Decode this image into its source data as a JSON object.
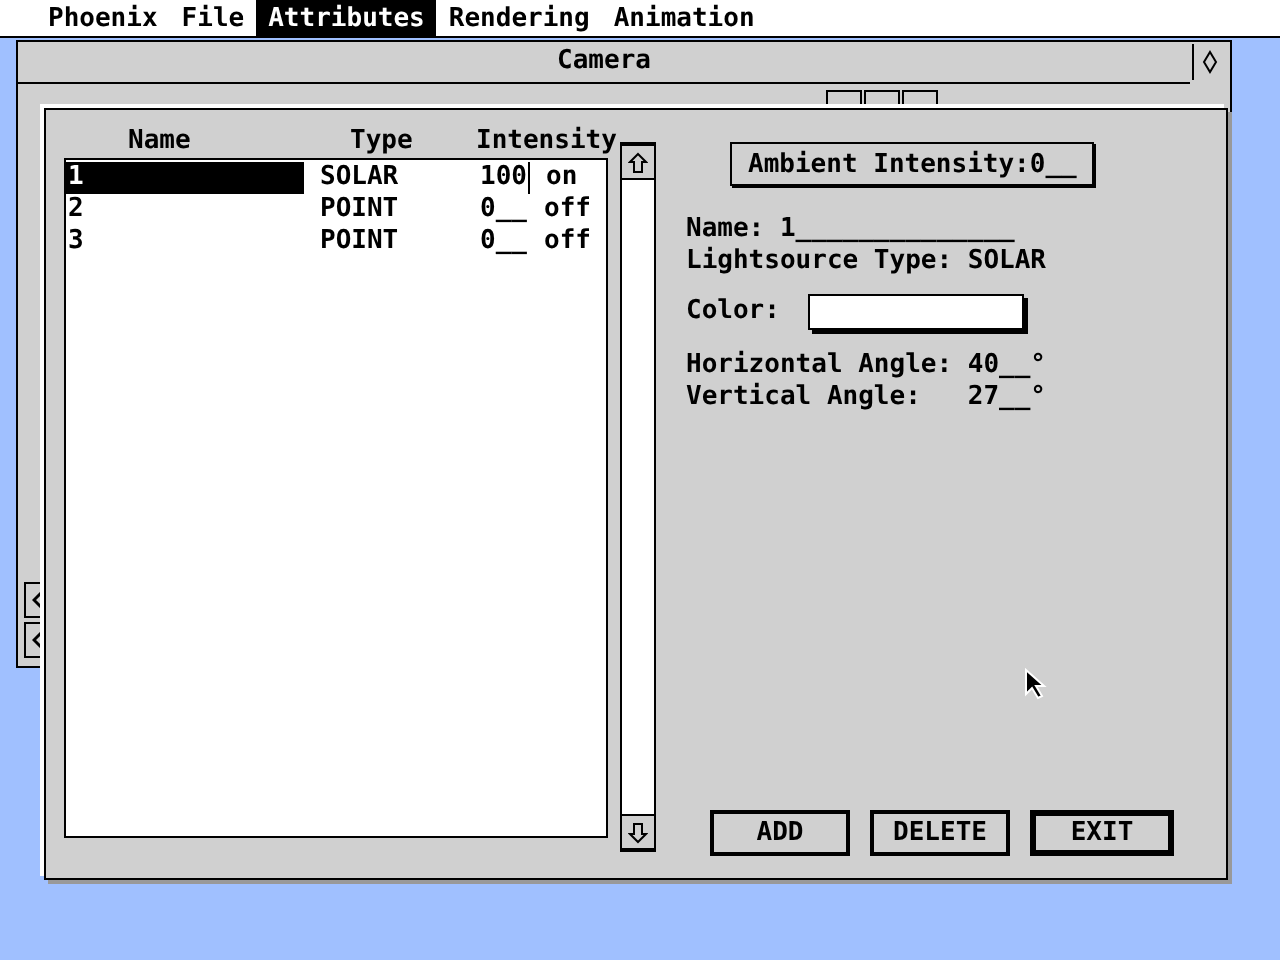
{
  "menu": [
    {
      "label": "Phoenix",
      "selected": false
    },
    {
      "label": "File",
      "selected": false
    },
    {
      "label": "Attributes",
      "selected": true
    },
    {
      "label": "Rendering",
      "selected": false
    },
    {
      "label": "Animation",
      "selected": false
    }
  ],
  "window": {
    "title": "Camera"
  },
  "dialog": {
    "columns": [
      "Name",
      "Type",
      "Intensity"
    ],
    "rows": [
      {
        "name": "1",
        "type": "SOLAR",
        "intensity": "100",
        "status": "on",
        "selected": true
      },
      {
        "name": "2",
        "type": "POINT",
        "intensity": "0__",
        "status": "off",
        "selected": false
      },
      {
        "name": "3",
        "type": "POINT",
        "intensity": "0__",
        "status": "off",
        "selected": false
      }
    ],
    "ambient_button": "Ambient Intensity:0__",
    "name_line": "Name: 1______________",
    "type_line": "Lightsource Type: SOLAR",
    "color_label": "Color:",
    "horizontal_line": "Horizontal Angle: 40__°",
    "vertical_line": "Vertical Angle:   27__°",
    "buttons": [
      {
        "label": "ADD",
        "default": false
      },
      {
        "label": "DELETE",
        "default": false
      },
      {
        "label": "EXIT",
        "default": true
      }
    ]
  }
}
